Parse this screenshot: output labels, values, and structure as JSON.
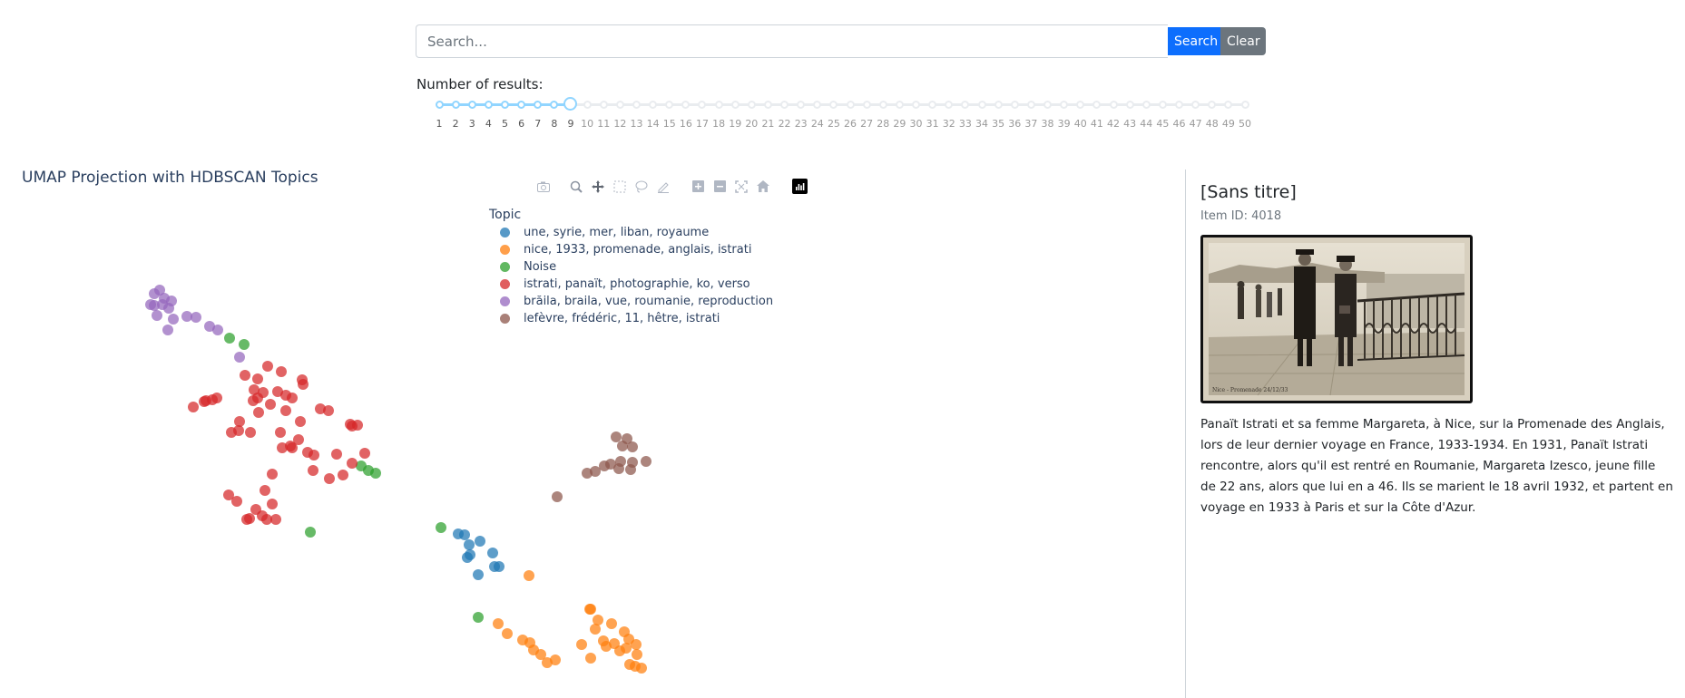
{
  "search": {
    "placeholder": "Search...",
    "value": "",
    "search_label": "Search",
    "clear_label": "Clear"
  },
  "results": {
    "label": "Number of results:",
    "min": 1,
    "max": 50,
    "value": 9,
    "slider_color": "#91d5ff"
  },
  "chart_data": {
    "type": "scatter",
    "title": "UMAP Projection with HDBSCAN Topics",
    "legend_title": "Topic",
    "legend_placement": "top-center",
    "grid": false,
    "series": [
      {
        "name": "une, syrie, mer, liban, royaume",
        "color": "#1f77b4",
        "points": [
          [
            505,
            589
          ],
          [
            512,
            590
          ],
          [
            517,
            601
          ],
          [
            529,
            597
          ],
          [
            518,
            612
          ],
          [
            543,
            610
          ],
          [
            545,
            625
          ],
          [
            515,
            615
          ],
          [
            550,
            625
          ],
          [
            527,
            634
          ]
        ]
      },
      {
        "name": "nice, 1933, promenade, anglais, istrati",
        "color": "#ff7f0e",
        "points": [
          [
            583,
            635
          ],
          [
            549,
            688
          ],
          [
            559,
            699
          ],
          [
            576,
            706
          ],
          [
            584,
            709
          ],
          [
            588,
            717
          ],
          [
            596,
            722
          ],
          [
            603,
            731
          ],
          [
            612,
            728
          ],
          [
            641,
            711
          ],
          [
            651,
            672
          ],
          [
            659,
            684
          ],
          [
            674,
            688
          ],
          [
            688,
            697
          ],
          [
            656,
            694
          ],
          [
            665,
            707
          ],
          [
            677,
            710
          ],
          [
            683,
            718
          ],
          [
            690,
            715
          ],
          [
            693,
            705
          ],
          [
            701,
            711
          ],
          [
            702,
            722
          ],
          [
            694,
            733
          ],
          [
            700,
            735
          ],
          [
            707,
            737
          ],
          [
            668,
            713
          ],
          [
            651,
            726
          ],
          [
            650,
            672
          ]
        ]
      },
      {
        "name": "Noise",
        "color": "#2ca02c",
        "points": [
          [
            253,
            373
          ],
          [
            269,
            380
          ],
          [
            398,
            514
          ],
          [
            406,
            519
          ],
          [
            414,
            522
          ],
          [
            342,
            587
          ],
          [
            486,
            582
          ],
          [
            527,
            681
          ]
        ]
      },
      {
        "name": "istrati, panaït, photographie, ko, verso",
        "color": "#d62728",
        "points": [
          [
            295,
            404
          ],
          [
            310,
            410
          ],
          [
            284,
            418
          ],
          [
            333,
            419
          ],
          [
            334,
            424
          ],
          [
            280,
            430
          ],
          [
            290,
            433
          ],
          [
            306,
            432
          ],
          [
            315,
            436
          ],
          [
            239,
            439
          ],
          [
            284,
            439
          ],
          [
            322,
            439
          ],
          [
            279,
            442
          ],
          [
            227,
            442
          ],
          [
            234,
            441
          ],
          [
            213,
            449
          ],
          [
            225,
            443
          ],
          [
            362,
            453
          ],
          [
            285,
            455
          ],
          [
            315,
            453
          ],
          [
            353,
            451
          ],
          [
            331,
            465
          ],
          [
            386,
            468
          ],
          [
            394,
            469
          ],
          [
            255,
            477
          ],
          [
            263,
            475
          ],
          [
            276,
            477
          ],
          [
            309,
            477
          ],
          [
            329,
            485
          ],
          [
            320,
            492
          ],
          [
            322,
            494
          ],
          [
            311,
            494
          ],
          [
            252,
            546
          ],
          [
            261,
            553
          ],
          [
            292,
            541
          ],
          [
            300,
            556
          ],
          [
            282,
            562
          ],
          [
            275,
            572
          ],
          [
            289,
            569
          ],
          [
            294,
            573
          ],
          [
            304,
            573
          ],
          [
            272,
            573
          ],
          [
            378,
            524
          ],
          [
            363,
            528
          ],
          [
            345,
            519
          ],
          [
            339,
            499
          ],
          [
            346,
            502
          ],
          [
            388,
            511
          ],
          [
            402,
            500
          ],
          [
            388,
            470
          ],
          [
            371,
            501
          ],
          [
            300,
            523
          ],
          [
            264,
            465
          ],
          [
            270,
            414
          ],
          [
            298,
            446
          ]
        ]
      },
      {
        "name": "brăila, braila, vue, roumanie, reproduction",
        "color": "#9467bd",
        "points": [
          [
            166,
            336
          ],
          [
            170,
            324
          ],
          [
            176,
            320
          ],
          [
            181,
            329
          ],
          [
            189,
            332
          ],
          [
            170,
            337
          ],
          [
            179,
            336
          ],
          [
            186,
            340
          ],
          [
            173,
            348
          ],
          [
            191,
            352
          ],
          [
            206,
            349
          ],
          [
            216,
            350
          ],
          [
            231,
            360
          ],
          [
            240,
            364
          ],
          [
            185,
            364
          ],
          [
            264,
            394
          ]
        ]
      },
      {
        "name": "lefèvre, frédéric, 11, hêtre, istrati",
        "color": "#8c564b",
        "points": [
          [
            679,
            482
          ],
          [
            691,
            484
          ],
          [
            686,
            492
          ],
          [
            697,
            493
          ],
          [
            673,
            512
          ],
          [
            684,
            509
          ],
          [
            697,
            510
          ],
          [
            695,
            518
          ],
          [
            712,
            509
          ],
          [
            666,
            514
          ],
          [
            682,
            517
          ],
          [
            656,
            520
          ],
          [
            647,
            522
          ],
          [
            614,
            548
          ]
        ]
      }
    ]
  },
  "modebar": {
    "icons": [
      "camera-icon",
      "zoom-icon",
      "pan-icon",
      "box-select-icon",
      "lasso-select-icon",
      "draw-icon",
      "zoom-in-icon",
      "zoom-out-icon",
      "autoscale-icon",
      "reset-axes-icon",
      "plotly-logo-icon"
    ]
  },
  "detail": {
    "title": "[Sans titre]",
    "item_id": "Item ID: 4018",
    "description": "Panaït Istrati et sa femme Margareta, à Nice, sur la Promenade des Anglais, lors de leur dernier voyage en France, 1933-1934. En 1931, Panaït Istrati rencontre, alors qu'il est rentré en Roumanie, Margareta Izesco, jeune fille de 22 ans, alors que lui en a 46. Ils se marient le 18 avril 1932, et partent en voyage en 1933 à Paris et sur la Côte d'Azur.",
    "photo_caption": "Nice - Promenade 24/12/33"
  }
}
